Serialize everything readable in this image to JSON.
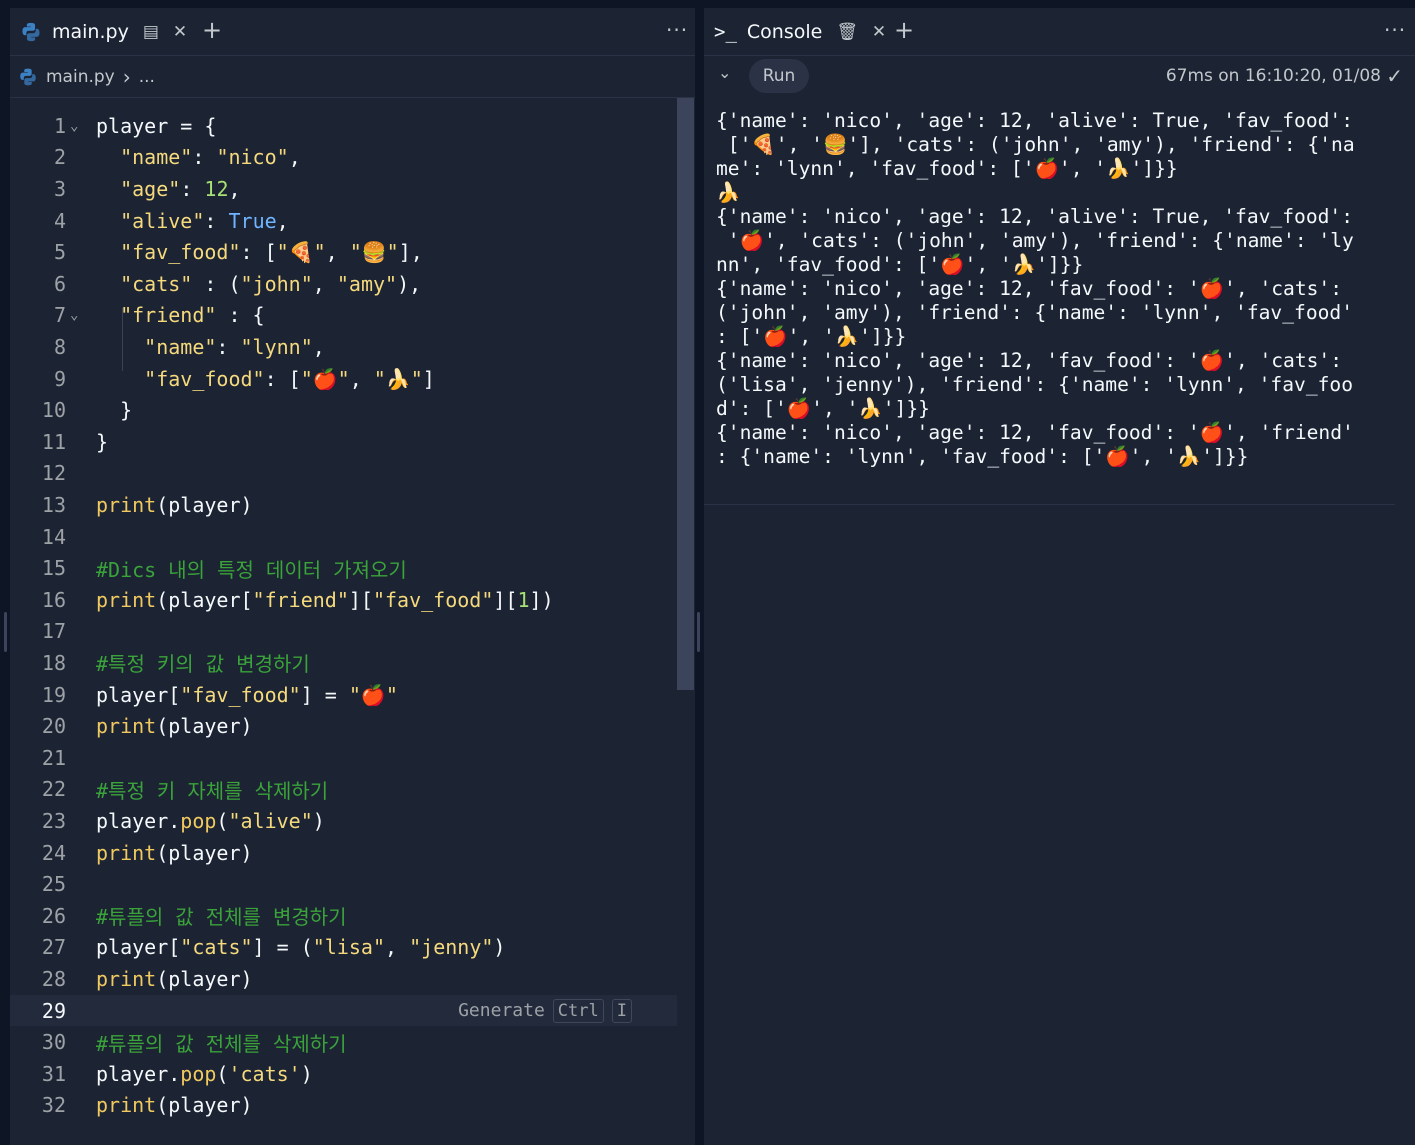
{
  "editor": {
    "tab_label": "main.py",
    "breadcrumb_file": "main.py",
    "breadcrumb_sep": "›",
    "breadcrumb_more": "...",
    "more_label": "···",
    "plus_label": "+",
    "generate_hint": {
      "label": "Generate",
      "key1": "Ctrl",
      "key2": "I"
    },
    "active_line": 29,
    "lines": [
      "1",
      "2",
      "3",
      "4",
      "5",
      "6",
      "7",
      "8",
      "9",
      "10",
      "11",
      "12",
      "13",
      "14",
      "15",
      "16",
      "17",
      "18",
      "19",
      "20",
      "21",
      "22",
      "23",
      "24",
      "25",
      "26",
      "27",
      "28",
      "29",
      "30",
      "31",
      "32"
    ],
    "code": {
      "l1": "player = {",
      "l2a": "  ",
      "l2s1": "\"name\"",
      "l2b": ": ",
      "l2s2": "\"nico\"",
      "l2c": ",",
      "l3s": "\"age\"",
      "l3b": ": ",
      "l3n": "12",
      "l3c": ",",
      "l4s": "\"alive\"",
      "l4b": ": ",
      "l4k": "True",
      "l4c": ",",
      "l5s": "\"fav_food\"",
      "l5b": ": [",
      "l5s2": "\"🍕\"",
      "l5c": ", ",
      "l5s3": "\"🍔\"",
      "l5d": "],",
      "l6s": "\"cats\"",
      "l6b": " : (",
      "l6s2": "\"john\"",
      "l6c": ", ",
      "l6s3": "\"amy\"",
      "l6d": "),",
      "l7s": "\"friend\"",
      "l7b": " : {",
      "l8s": "\"name\"",
      "l8b": ": ",
      "l8s2": "\"lynn\"",
      "l8c": ",",
      "l9s": "\"fav_food\"",
      "l9b": ": [",
      "l9s2": "\"🍎\"",
      "l9c": ", ",
      "l9s3": "\"🍌\"",
      "l9d": "]",
      "l10": "}",
      "l11": "}",
      "l13f": "print",
      "l13b": "(player)",
      "l15": "#Dics 내의 특정 데이터 가져오기",
      "l16f": "print",
      "l16a": "(player[",
      "l16s1": "\"friend\"",
      "l16b": "][",
      "l16s2": "\"fav_food\"",
      "l16c": "][",
      "l16n": "1",
      "l16d": "])",
      "l18": "#특정 키의 값 변경하기",
      "l19a": "player[",
      "l19s": "\"fav_food\"",
      "l19b": "] = ",
      "l19s2": "\"🍎\"",
      "l20f": "print",
      "l20b": "(player)",
      "l22": "#특정 키 자체를 삭제하기",
      "l23a": "player.",
      "l23f": "pop",
      "l23b": "(",
      "l23s": "\"alive\"",
      "l23c": ")",
      "l24f": "print",
      "l24b": "(player)",
      "l26": "#튜플의 값 전체를 변경하기",
      "l27a": "player[",
      "l27s": "\"cats\"",
      "l27b": "] = (",
      "l27s2": "\"lisa\"",
      "l27c": ", ",
      "l27s3": "\"jenny\"",
      "l27d": ")",
      "l28f": "print",
      "l28b": "(player)",
      "l30": "#튜플의 값 전체를 삭제하기",
      "l31a": "player.",
      "l31f": "pop",
      "l31b": "(",
      "l31s": "'cats'",
      "l31c": ")",
      "l32f": "print",
      "l32b": "(player)"
    }
  },
  "console": {
    "tab_label": "Console",
    "run_label": "Run",
    "status": "67ms on 16:10:20, 01/08",
    "more_label": "···",
    "plus_label": "+",
    "output": "{'name': 'nico', 'age': 12, 'alive': True, 'fav_food':\n ['🍕', '🍔'], 'cats': ('john', 'amy'), 'friend': {'na\nme': 'lynn', 'fav_food': ['🍎', '🍌']}}\n🍌\n{'name': 'nico', 'age': 12, 'alive': True, 'fav_food':\n '🍎', 'cats': ('john', 'amy'), 'friend': {'name': 'ly\nnn', 'fav_food': ['🍎', '🍌']}}\n{'name': 'nico', 'age': 12, 'fav_food': '🍎', 'cats':\n('john', 'amy'), 'friend': {'name': 'lynn', 'fav_food'\n: ['🍎', '🍌']}}\n{'name': 'nico', 'age': 12, 'fav_food': '🍎', 'cats':\n('lisa', 'jenny'), 'friend': {'name': 'lynn', 'fav_foo\nd': ['🍎', '🍌']}}\n{'name': 'nico', 'age': 12, 'fav_food': '🍎', 'friend'\n: {'name': 'lynn', 'fav_food': ['🍎', '🍌']}}"
  },
  "colors": {
    "background": "#0e1525",
    "panel": "#1c2333",
    "string": "#f5d97d",
    "number": "#a7e075",
    "keyword": "#6fb5ff",
    "function": "#f0c960",
    "comment": "#3aa33a"
  }
}
